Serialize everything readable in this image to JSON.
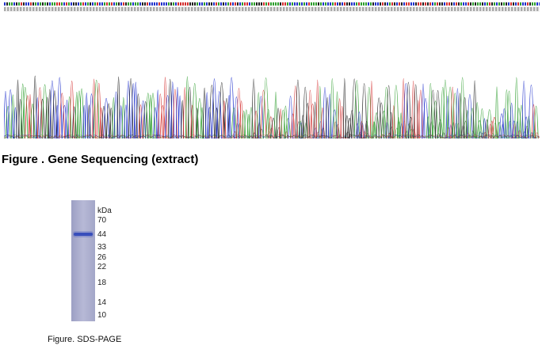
{
  "sequencing_figure": {
    "caption": "Figure . Gene Sequencing (extract)",
    "trace_colors": {
      "A": "#2e9e2e",
      "C": "#2233cc",
      "G": "#222222",
      "T": "#d43030"
    }
  },
  "sds_page_figure": {
    "caption": "Figure. SDS-PAGE",
    "unit_label": "kDa",
    "markers": [
      "70",
      "44",
      "33",
      "26",
      "22",
      "18",
      "14",
      "10"
    ],
    "band_color": "#2b44b8",
    "lane_color": "#b4b6d2"
  }
}
